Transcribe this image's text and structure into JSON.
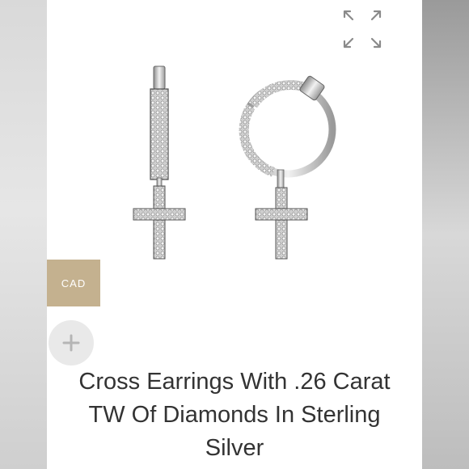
{
  "toolbar": {
    "expand_icon": "expand-arrows-icon",
    "currency_label": "CAD",
    "add_icon": "plus-icon"
  },
  "product": {
    "image_subject": "cross-earrings-image",
    "title": "Cross Earrings With .26 Carat TW Of Diamonds In Sterling Silver"
  },
  "colors": {
    "currency_bg": "#c4b18f",
    "add_bg": "#e9e9e9",
    "title_text": "#333333",
    "icon_gray": "#8a8a8a"
  }
}
